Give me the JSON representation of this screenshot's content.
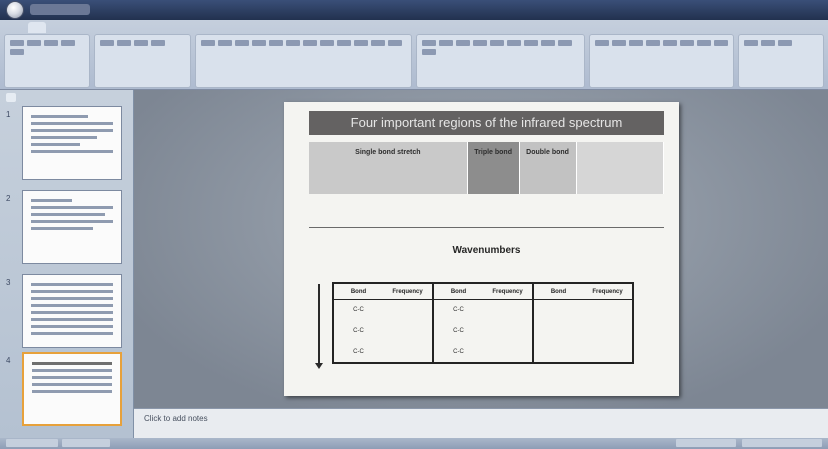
{
  "titlebar": {
    "title": ""
  },
  "ribbon": {
    "tabs": [
      "",
      "",
      "",
      "",
      "",
      "",
      "",
      ""
    ],
    "active_tab": 0,
    "groups": [
      "",
      "",
      "",
      "",
      "",
      ""
    ]
  },
  "slides_pane": {
    "tabs": [
      "",
      ""
    ],
    "thumbnails": [
      1,
      2,
      3,
      4
    ]
  },
  "slide": {
    "title": "Four important regions of the infrared spectrum",
    "regions": [
      {
        "bonds": "",
        "name": "Single bond stretch"
      },
      {
        "bonds": "",
        "name": "Triple bond"
      },
      {
        "bonds": "",
        "name": "Double bond"
      },
      {
        "bonds": "",
        "name": ""
      }
    ],
    "axis_title": "Wavenumbers",
    "ticks": [
      "",
      "",
      "",
      "",
      "",
      "",
      ""
    ],
    "note": "",
    "table": [
      {
        "headers": [
          "Bond",
          "Frequency"
        ],
        "rows": [
          [
            "C-C",
            ""
          ],
          [
            "C-C",
            ""
          ],
          [
            "C-C",
            ""
          ]
        ]
      },
      {
        "headers": [
          "Bond",
          "Frequency"
        ],
        "rows": [
          [
            "C-C",
            ""
          ],
          [
            "C-C",
            ""
          ],
          [
            "C-C",
            ""
          ]
        ]
      },
      {
        "headers": [
          "Bond",
          "Frequency"
        ],
        "rows": [
          [
            "",
            ""
          ],
          [
            "",
            ""
          ],
          [
            "",
            ""
          ]
        ]
      }
    ]
  },
  "notes": {
    "placeholder": "Click to add notes"
  },
  "colors": {
    "title_bg": "#646262",
    "region_1": "#c9c9c9",
    "region_2": "#8d8d8d",
    "region_3": "#c2c2c2",
    "region_4": "#d6d6d6",
    "selection": "#e7a13b"
  }
}
